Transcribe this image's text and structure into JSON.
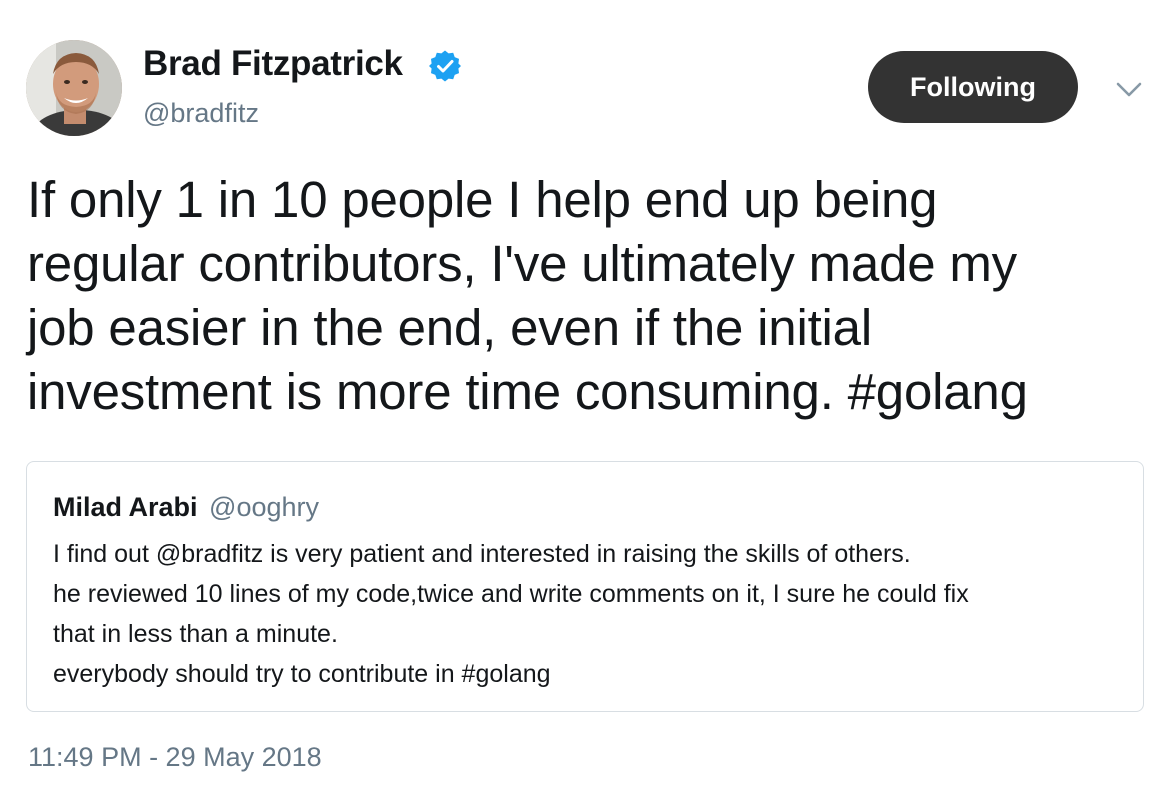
{
  "author": {
    "display_name": "Brad Fitzpatrick",
    "handle": "@bradfitz",
    "verified": true,
    "avatar_icon": "avatar-photo"
  },
  "actions": {
    "follow_label": "Following",
    "menu_icon": "chevron-down-icon"
  },
  "tweet": {
    "text_lines": [
      "If only 1 in 10 people I help end up being",
      "regular contributors, I've ultimately made my",
      "job easier in the end, even if the initial",
      "investment is more time consuming. ",
      "#golang"
    ]
  },
  "quote": {
    "display_name": "Milad Arabi",
    "handle": "@ooghry",
    "text_lines": [
      "I find out @bradfitz is very patient and interested in raising the skills of others.",
      "he reviewed 10 lines of my code,twice and write comments on it, I sure he could fix",
      "that in less than a minute.",
      "everybody should try to contribute in #golang"
    ]
  },
  "timestamp": "11:49 PM - 29 May 2018",
  "colors": {
    "verified_blue": "#1da1f2",
    "follow_button_bg": "#333333",
    "secondary_text": "#657786",
    "border": "#d8dee3"
  }
}
